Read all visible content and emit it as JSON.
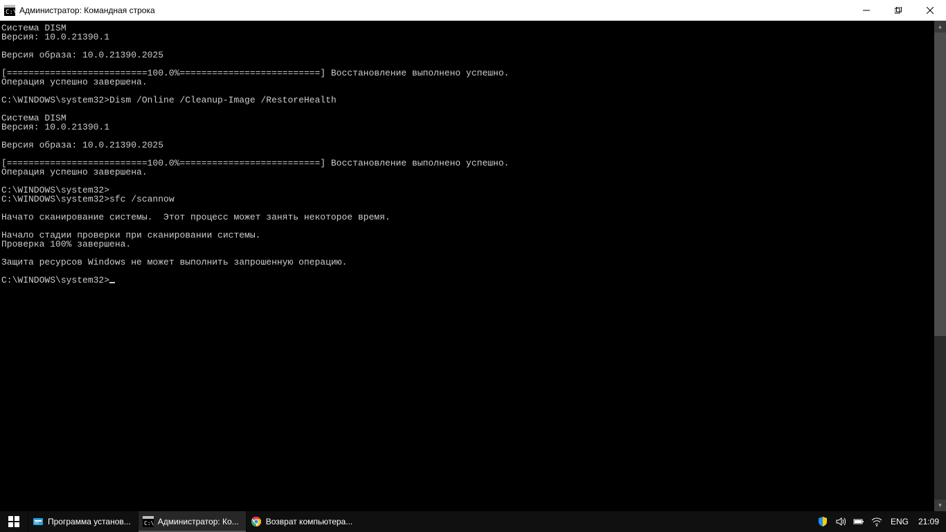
{
  "window": {
    "title": "Администратор: Командная строка"
  },
  "console": {
    "lines": [
      "Система DISM",
      "Версия: 10.0.21390.1",
      "",
      "Версия образа: 10.0.21390.2025",
      "",
      "[==========================100.0%==========================] Восстановление выполнено успешно.",
      "Операция успешно завершена.",
      "",
      "C:\\WINDOWS\\system32>Dism /Online /Cleanup-Image /RestoreHealth",
      "",
      "Система DISM",
      "Версия: 10.0.21390.1",
      "",
      "Версия образа: 10.0.21390.2025",
      "",
      "[==========================100.0%==========================] Восстановление выполнено успешно.",
      "Операция успешно завершена.",
      "",
      "C:\\WINDOWS\\system32>",
      "C:\\WINDOWS\\system32>sfc /scannow",
      "",
      "Начато сканирование системы.  Этот процесс может занять некоторое время.",
      "",
      "Начало стадии проверки при сканировании системы.",
      "Проверка 100% завершена.",
      "",
      "Защита ресурсов Windows не может выполнить запрошенную операцию.",
      ""
    ],
    "prompt": "C:\\WINDOWS\\system32>"
  },
  "taskbar": {
    "items": [
      {
        "label": "Программа установ...",
        "icon": "installer"
      },
      {
        "label": "Администратор: Ко...",
        "icon": "cmd"
      },
      {
        "label": "Возврат компьютера...",
        "icon": "chrome"
      }
    ],
    "language": "ENG",
    "clock": "21:09"
  }
}
